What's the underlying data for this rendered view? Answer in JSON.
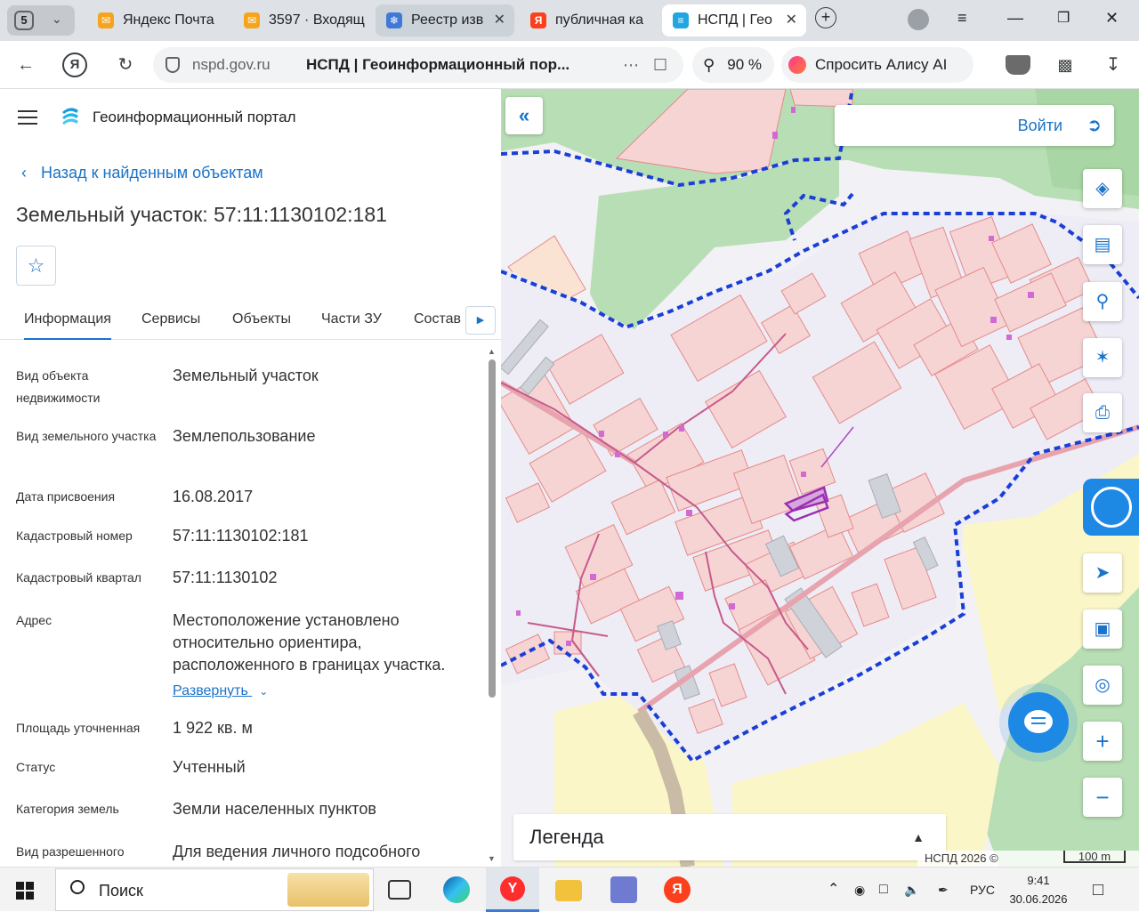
{
  "browser": {
    "tab_count": "5",
    "tabs": [
      {
        "label": "Яндекс Почта",
        "icon": "mail-icon"
      },
      {
        "label": "3597 · Входящ",
        "icon": "mail-icon"
      },
      {
        "label": "Реестр изв",
        "icon": "emblem-icon"
      },
      {
        "label": "публичная ка",
        "icon": "yandex-icon"
      },
      {
        "label": "НСПД | Гео",
        "icon": "nspd-icon"
      }
    ],
    "domain": "nspd.gov.ru",
    "page_title": "НСПД | Геоинформационный пор...",
    "zoom": "90 %",
    "alice_label": "Спросить Алису AI"
  },
  "portal": {
    "title": "Геоинформационный портал",
    "back_label": "Назад к найденным объектам",
    "object_title": "Земельный участок: 57:11:1130102:181"
  },
  "tabs": [
    "Информация",
    "Сервисы",
    "Объекты",
    "Части ЗУ",
    "Состав"
  ],
  "properties": [
    {
      "label": "Вид объекта недвижимости",
      "value": "Земельный участок"
    },
    {
      "label": "Вид земельного участка",
      "value": "Землепользование"
    },
    {
      "label": "Дата присвоения",
      "value": "16.08.2017"
    },
    {
      "label": "Кадастровый номер",
      "value": "57:11:1130102:181"
    },
    {
      "label": "Кадастровый квартал",
      "value": "57:11:1130102"
    },
    {
      "label": "Адрес",
      "value": "Местоположение установлено относительно ориентира, расположенного в границах участка.",
      "link": "Развернуть"
    },
    {
      "label": "Площадь уточненная",
      "value": "1 922 кв. м"
    },
    {
      "label": "Статус",
      "value": "Учтенный"
    },
    {
      "label": "Категория земель",
      "value": "Земли населенных пунктов"
    },
    {
      "label": "Вид разрешенного",
      "value": "Для ведения личного подсобного"
    }
  ],
  "map": {
    "login_label": "Войти",
    "legend_label": "Легенда",
    "copyright": "НСПД 2026 ©",
    "scale": "100 m",
    "colors": {
      "parcel_fill": "#f6d4d4",
      "parcel_stroke": "#e58a8a",
      "boundary": "#1a3fd6",
      "forest": "#b8deb5",
      "field": "#fbf6c8",
      "selected": "#9b2fb3"
    }
  },
  "taskbar": {
    "search_label": "Поиск",
    "language": "РУС",
    "time": "9:41",
    "date": "30.06.2026"
  }
}
